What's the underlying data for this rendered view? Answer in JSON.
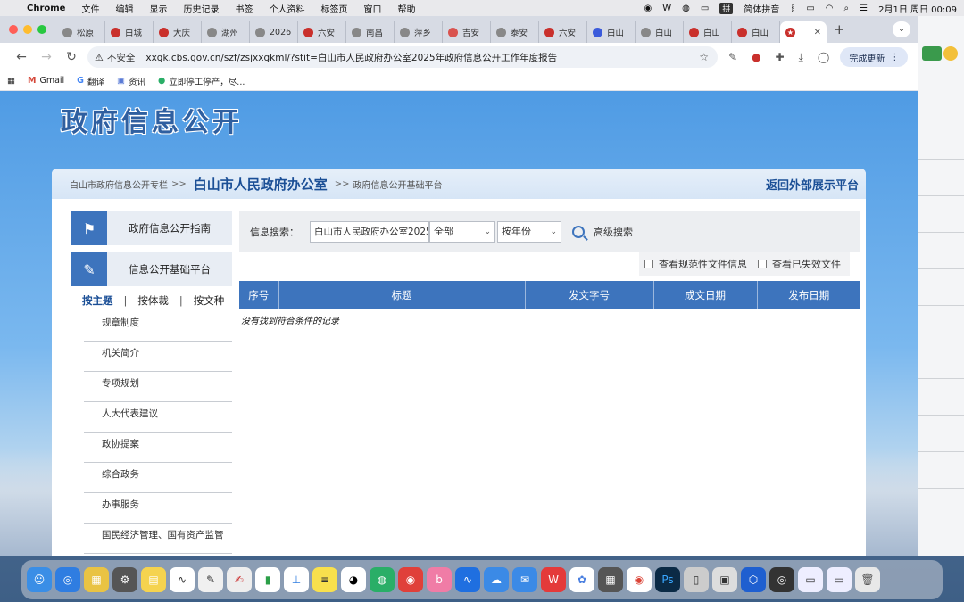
{
  "menubar": {
    "app": "Chrome",
    "items": [
      "文件",
      "编辑",
      "显示",
      "历史记录",
      "书签",
      "个人资料",
      "标签页",
      "窗口",
      "帮助"
    ],
    "ime": "拼",
    "ime_label": "简体拼音",
    "datetime": "2月1日 周日  00:09"
  },
  "tabs": [
    {
      "label": "松原",
      "color": "#888888"
    },
    {
      "label": "白城",
      "color": "#c9302c"
    },
    {
      "label": "大庆",
      "color": "#c9302c"
    },
    {
      "label": "湖州",
      "color": "#888888"
    },
    {
      "label": "2026",
      "color": "#888888"
    },
    {
      "label": "六安",
      "color": "#c9302c"
    },
    {
      "label": "南昌",
      "color": "#888888"
    },
    {
      "label": "萍乡",
      "color": "#888888"
    },
    {
      "label": "吉安",
      "color": "#d9534f"
    },
    {
      "label": "泰安",
      "color": "#888888"
    },
    {
      "label": "六安",
      "color": "#c9302c"
    },
    {
      "label": "白山",
      "color": "#3b5bdb"
    },
    {
      "label": "白山",
      "color": "#888888"
    },
    {
      "label": "白山",
      "color": "#c9302c"
    },
    {
      "label": "白山",
      "color": "#c9302c"
    }
  ],
  "active_tab": {
    "label": "",
    "color": "#c9302c"
  },
  "toolbar": {
    "insecure": "不安全",
    "url": "xxgk.cbs.gov.cn/szf/zsjxxgkml/?stit=白山市人民政府办公室2025年政府信息公开工作年度报告",
    "update": "完成更新"
  },
  "bookmarks": [
    {
      "label": "Gmail",
      "icon": "M"
    },
    {
      "label": "翻译",
      "icon": "G"
    },
    {
      "label": "资讯",
      "icon": "▣"
    },
    {
      "label": "立即停工停产，尽...",
      "icon": "●"
    }
  ],
  "page": {
    "site_title": "政府信息公开",
    "breadcrumb": {
      "root": "白山市政府信息公开专栏",
      "sep1": ">>",
      "current": "白山市人民政府办公室",
      "sep2": ">>",
      "tail": "政府信息公开基础平台"
    },
    "back_link": "返回外部展示平台",
    "side_buttons": [
      {
        "label": "政府信息公开指南",
        "icon": "flag-icon",
        "glyph": "⚑"
      },
      {
        "label": "信息公开基础平台",
        "icon": "edit-icon",
        "glyph": "✎"
      }
    ],
    "filters": {
      "by_theme": "按主题",
      "by_genre": "按体裁",
      "by_doctype": "按文种",
      "bar": "|"
    },
    "categories": [
      "规章制度",
      "机关简介",
      "专项规划",
      "人大代表建议",
      "政协提案",
      "综合政务",
      "办事服务",
      "国民经济管理、国有资产监管"
    ],
    "search": {
      "label": "信息搜索：",
      "value": "白山市人民政府办公室2025",
      "scope": "全部",
      "year": "按年份",
      "advanced": "高级搜索",
      "check_normative": "查看规范性文件信息",
      "check_invalid": "查看已失效文件"
    },
    "table_headers": [
      "序号",
      "标题",
      "发文字号",
      "成文日期",
      "发布日期"
    ],
    "empty_message": "没有找到符合条件的记录"
  }
}
